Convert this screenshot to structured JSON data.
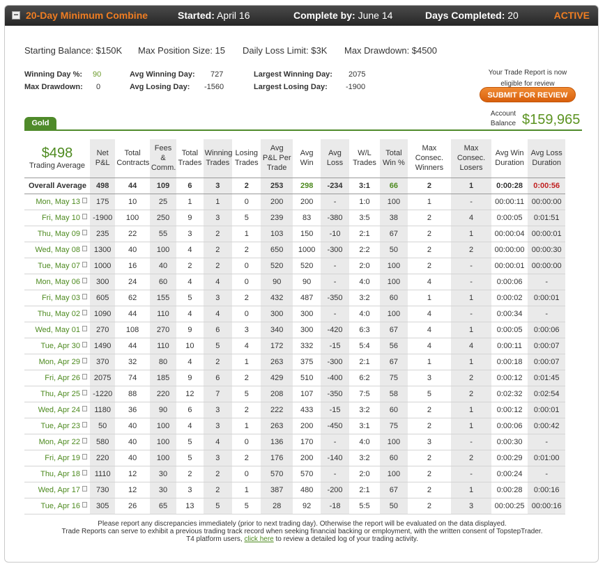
{
  "header": {
    "collapse_symbol": "−",
    "title": "20-Day Minimum Combine",
    "started_label": "Started:",
    "started_value": "April 16",
    "complete_label": "Complete by:",
    "complete_value": "June 14",
    "days_label": "Days Completed:",
    "days_value": "20",
    "status": "ACTIVE"
  },
  "summary": {
    "starting_balance": "Starting Balance: $150K",
    "max_position": "Max Position Size: 15",
    "daily_loss": "Daily Loss Limit: $3K",
    "max_drawdown": "Max Drawdown: $4500"
  },
  "stats": {
    "winning_day_pct_label": "Winning Day %:",
    "winning_day_pct": "90",
    "max_drawdown_label": "Max Drawdown:",
    "max_drawdown": "0",
    "avg_winning_day_label": "Avg Winning Day:",
    "avg_winning_day": "727",
    "avg_losing_day_label": "Avg Losing Day:",
    "avg_losing_day": "-1560",
    "largest_winning_day_label": "Largest Winning Day:",
    "largest_winning_day": "2075",
    "largest_losing_day_label": "Largest Losing Day:",
    "largest_losing_day": "-1900"
  },
  "review": {
    "eligible_line1": "Your Trade Report is now",
    "eligible_line2": "eligible for review",
    "submit_label": "SUBMIT FOR REVIEW",
    "account_label_1": "Account",
    "account_label_2": "Balance",
    "account_balance": "$159,965"
  },
  "tab": {
    "label": "Gold"
  },
  "table": {
    "trading_average": "$498",
    "trading_average_label": "Trading Average",
    "headers": [
      "Net P&L",
      "Total Contracts",
      "Fees & Comm.",
      "Total Trades",
      "Winning Trades",
      "Losing Trades",
      "Avg P&L Per Trade",
      "Avg Win",
      "Avg Loss",
      "W/L Trades",
      "Total Win %",
      "Max Consec. Winners",
      "Max Consec. Losers",
      "Avg Win Duration",
      "Avg Loss Duration"
    ],
    "overall": [
      "Overall Average",
      "498",
      "44",
      "109",
      "6",
      "3",
      "2",
      "253",
      "298",
      "-234",
      "3:1",
      "66",
      "2",
      "1",
      "0:00:28",
      "0:00:56"
    ],
    "rows": [
      [
        "Mon, May 13",
        "175",
        "10",
        "25",
        "1",
        "1",
        "0",
        "200",
        "200",
        "-",
        "1:0",
        "100",
        "1",
        "-",
        "00:00:11",
        "00:00:00"
      ],
      [
        "Fri, May 10",
        "-1900",
        "100",
        "250",
        "9",
        "3",
        "5",
        "239",
        "83",
        "-380",
        "3:5",
        "38",
        "2",
        "4",
        "0:00:05",
        "0:01:51"
      ],
      [
        "Thu, May 09",
        "235",
        "22",
        "55",
        "3",
        "2",
        "1",
        "103",
        "150",
        "-10",
        "2:1",
        "67",
        "2",
        "1",
        "00:00:04",
        "00:00:01"
      ],
      [
        "Wed, May 08",
        "1300",
        "40",
        "100",
        "4",
        "2",
        "2",
        "650",
        "1000",
        "-300",
        "2:2",
        "50",
        "2",
        "2",
        "00:00:00",
        "00:00:30"
      ],
      [
        "Tue, May 07",
        "1000",
        "16",
        "40",
        "2",
        "2",
        "0",
        "520",
        "520",
        "-",
        "2:0",
        "100",
        "2",
        "-",
        "00:00:01",
        "00:00:00"
      ],
      [
        "Mon, May 06",
        "300",
        "24",
        "60",
        "4",
        "4",
        "0",
        "90",
        "90",
        "-",
        "4:0",
        "100",
        "4",
        "-",
        "0:00:06",
        "-"
      ],
      [
        "Fri, May 03",
        "605",
        "62",
        "155",
        "5",
        "3",
        "2",
        "432",
        "487",
        "-350",
        "3:2",
        "60",
        "1",
        "1",
        "0:00:02",
        "0:00:01"
      ],
      [
        "Thu, May 02",
        "1090",
        "44",
        "110",
        "4",
        "4",
        "0",
        "300",
        "300",
        "-",
        "4:0",
        "100",
        "4",
        "-",
        "0:00:34",
        "-"
      ],
      [
        "Wed, May 01",
        "270",
        "108",
        "270",
        "9",
        "6",
        "3",
        "340",
        "300",
        "-420",
        "6:3",
        "67",
        "4",
        "1",
        "0:00:05",
        "0:00:06"
      ],
      [
        "Tue, Apr 30",
        "1490",
        "44",
        "110",
        "10",
        "5",
        "4",
        "172",
        "332",
        "-15",
        "5:4",
        "56",
        "4",
        "4",
        "0:00:11",
        "0:00:07"
      ],
      [
        "Mon, Apr 29",
        "370",
        "32",
        "80",
        "4",
        "2",
        "1",
        "263",
        "375",
        "-300",
        "2:1",
        "67",
        "1",
        "1",
        "0:00:18",
        "0:00:07"
      ],
      [
        "Fri, Apr 26",
        "2075",
        "74",
        "185",
        "9",
        "6",
        "2",
        "429",
        "510",
        "-400",
        "6:2",
        "75",
        "3",
        "2",
        "0:00:12",
        "0:01:45"
      ],
      [
        "Thu, Apr 25",
        "-1220",
        "88",
        "220",
        "12",
        "7",
        "5",
        "208",
        "107",
        "-350",
        "7:5",
        "58",
        "5",
        "2",
        "0:02:32",
        "0:02:54"
      ],
      [
        "Wed, Apr 24",
        "1180",
        "36",
        "90",
        "6",
        "3",
        "2",
        "222",
        "433",
        "-15",
        "3:2",
        "60",
        "2",
        "1",
        "0:00:12",
        "0:00:01"
      ],
      [
        "Tue, Apr 23",
        "50",
        "40",
        "100",
        "4",
        "3",
        "1",
        "263",
        "200",
        "-450",
        "3:1",
        "75",
        "2",
        "1",
        "0:00:06",
        "0:00:42"
      ],
      [
        "Mon, Apr 22",
        "580",
        "40",
        "100",
        "5",
        "4",
        "0",
        "136",
        "170",
        "-",
        "4:0",
        "100",
        "3",
        "-",
        "0:00:30",
        "-"
      ],
      [
        "Fri, Apr 19",
        "220",
        "40",
        "100",
        "5",
        "3",
        "2",
        "176",
        "200",
        "-140",
        "3:2",
        "60",
        "2",
        "2",
        "0:00:29",
        "0:01:00"
      ],
      [
        "Thu, Apr 18",
        "1110",
        "12",
        "30",
        "2",
        "2",
        "0",
        "570",
        "570",
        "-",
        "2:0",
        "100",
        "2",
        "-",
        "0:00:24",
        "-"
      ],
      [
        "Wed, Apr 17",
        "730",
        "12",
        "30",
        "3",
        "2",
        "1",
        "387",
        "480",
        "-200",
        "2:1",
        "67",
        "2",
        "1",
        "0:00:28",
        "0:00:16"
      ],
      [
        "Tue, Apr 16",
        "305",
        "26",
        "65",
        "13",
        "5",
        "5",
        "28",
        "92",
        "-18",
        "5:5",
        "50",
        "2",
        "3",
        "00:00:25",
        "00:00:16"
      ]
    ]
  },
  "footer": {
    "line1": "Please report any discrepancies immediately (prior to next trading day). Otherwise the report will be evaluated on the data displayed.",
    "line2": "Trade Reports can serve to exhibit a previous trading track record when seeking financial backing or employment, with the written consent of TopstepTrader.",
    "line3_prefix": "T4 platform users,",
    "line3_link": "click here",
    "line3_suffix": "to review a detailed log of your trading activity."
  },
  "colors": {
    "accent_orange": "#ef7d22",
    "green": "#4d8a1f",
    "red": "#c02020",
    "header_dark": "#2f2f2f"
  }
}
